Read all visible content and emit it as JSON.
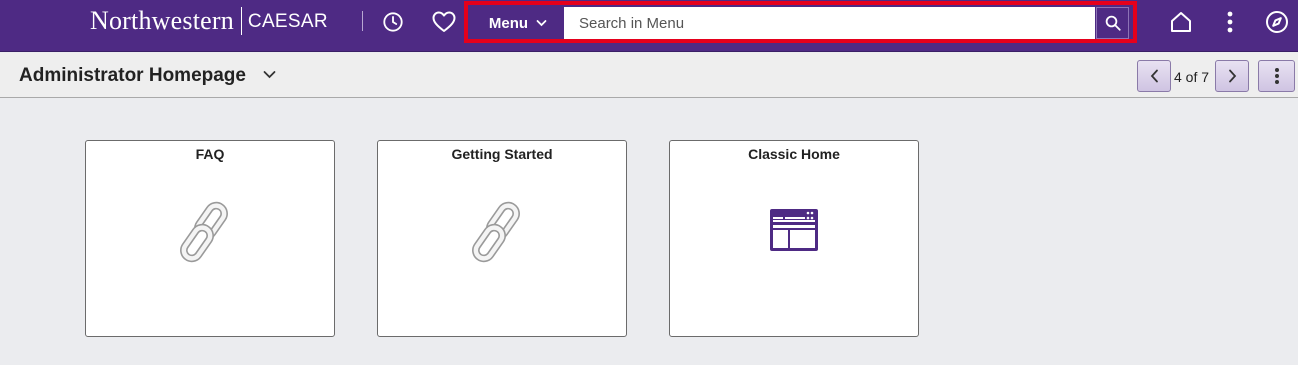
{
  "header": {
    "brand_name": "Northwestern",
    "app_name": "CAESAR",
    "menu_label": "Menu",
    "search_placeholder": "Search in Menu",
    "accent_color": "#4e2a84",
    "highlight_color": "#e5001c",
    "icons": [
      "clock-icon",
      "heart-icon",
      "search-icon",
      "home-icon",
      "more-vertical-icon",
      "compass-icon"
    ]
  },
  "page": {
    "title": "Administrator Homepage",
    "pager_text": "4 of 7"
  },
  "tiles": [
    {
      "title": "FAQ",
      "icon": "link-icon"
    },
    {
      "title": "Getting Started",
      "icon": "link-icon"
    },
    {
      "title": "Classic Home",
      "icon": "classic-home-icon"
    }
  ]
}
